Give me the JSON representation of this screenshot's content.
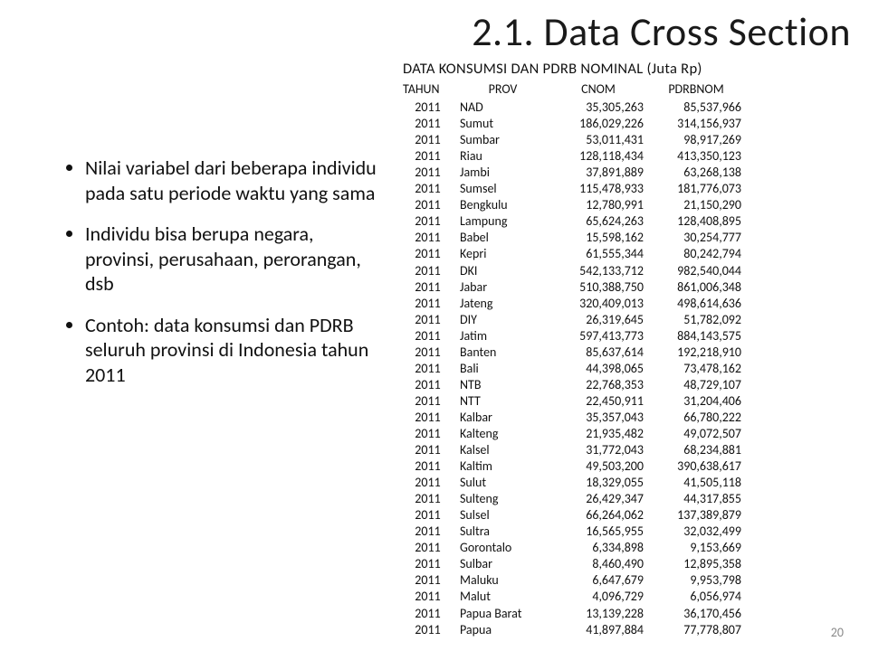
{
  "title": "2.1. Data Cross Section",
  "bullets": [
    "Nilai variabel dari beberapa individu pada satu periode waktu yang sama",
    "Individu bisa berupa negara, provinsi, perusahaan, perorangan, dsb",
    "Contoh: data konsumsi dan PDRB seluruh provinsi di Indonesia tahun 2011"
  ],
  "table": {
    "caption": "DATA KONSUMSI DAN PDRB NOMINAL (Juta Rp)",
    "headers": {
      "tahun": "TAHUN",
      "prov": "PROV",
      "cnom": "CNOM",
      "pdrbnom": "PDRBNOM"
    },
    "rows": [
      {
        "tahun": "2011",
        "prov": "NAD",
        "cnom": "35,305,263",
        "pdrbnom": "85,537,966"
      },
      {
        "tahun": "2011",
        "prov": "Sumut",
        "cnom": "186,029,226",
        "pdrbnom": "314,156,937"
      },
      {
        "tahun": "2011",
        "prov": "Sumbar",
        "cnom": "53,011,431",
        "pdrbnom": "98,917,269"
      },
      {
        "tahun": "2011",
        "prov": "Riau",
        "cnom": "128,118,434",
        "pdrbnom": "413,350,123"
      },
      {
        "tahun": "2011",
        "prov": "Jambi",
        "cnom": "37,891,889",
        "pdrbnom": "63,268,138"
      },
      {
        "tahun": "2011",
        "prov": "Sumsel",
        "cnom": "115,478,933",
        "pdrbnom": "181,776,073"
      },
      {
        "tahun": "2011",
        "prov": "Bengkulu",
        "cnom": "12,780,991",
        "pdrbnom": "21,150,290"
      },
      {
        "tahun": "2011",
        "prov": "Lampung",
        "cnom": "65,624,263",
        "pdrbnom": "128,408,895"
      },
      {
        "tahun": "2011",
        "prov": "Babel",
        "cnom": "15,598,162",
        "pdrbnom": "30,254,777"
      },
      {
        "tahun": "2011",
        "prov": "Kepri",
        "cnom": "61,555,344",
        "pdrbnom": "80,242,794"
      },
      {
        "tahun": "2011",
        "prov": "DKI",
        "cnom": "542,133,712",
        "pdrbnom": "982,540,044"
      },
      {
        "tahun": "2011",
        "prov": "Jabar",
        "cnom": "510,388,750",
        "pdrbnom": "861,006,348"
      },
      {
        "tahun": "2011",
        "prov": "Jateng",
        "cnom": "320,409,013",
        "pdrbnom": "498,614,636"
      },
      {
        "tahun": "2011",
        "prov": "DIY",
        "cnom": "26,319,645",
        "pdrbnom": "51,782,092"
      },
      {
        "tahun": "2011",
        "prov": "Jatim",
        "cnom": "597,413,773",
        "pdrbnom": "884,143,575"
      },
      {
        "tahun": "2011",
        "prov": "Banten",
        "cnom": "85,637,614",
        "pdrbnom": "192,218,910"
      },
      {
        "tahun": "2011",
        "prov": "Bali",
        "cnom": "44,398,065",
        "pdrbnom": "73,478,162"
      },
      {
        "tahun": "2011",
        "prov": "NTB",
        "cnom": "22,768,353",
        "pdrbnom": "48,729,107"
      },
      {
        "tahun": "2011",
        "prov": "NTT",
        "cnom": "22,450,911",
        "pdrbnom": "31,204,406"
      },
      {
        "tahun": "2011",
        "prov": "Kalbar",
        "cnom": "35,357,043",
        "pdrbnom": "66,780,222"
      },
      {
        "tahun": "2011",
        "prov": "Kalteng",
        "cnom": "21,935,482",
        "pdrbnom": "49,072,507"
      },
      {
        "tahun": "2011",
        "prov": "Kalsel",
        "cnom": "31,772,043",
        "pdrbnom": "68,234,881"
      },
      {
        "tahun": "2011",
        "prov": "Kaltim",
        "cnom": "49,503,200",
        "pdrbnom": "390,638,617"
      },
      {
        "tahun": "2011",
        "prov": "Sulut",
        "cnom": "18,329,055",
        "pdrbnom": "41,505,118"
      },
      {
        "tahun": "2011",
        "prov": "Sulteng",
        "cnom": "26,429,347",
        "pdrbnom": "44,317,855"
      },
      {
        "tahun": "2011",
        "prov": "Sulsel",
        "cnom": "66,264,062",
        "pdrbnom": "137,389,879"
      },
      {
        "tahun": "2011",
        "prov": "Sultra",
        "cnom": "16,565,955",
        "pdrbnom": "32,032,499"
      },
      {
        "tahun": "2011",
        "prov": "Gorontalo",
        "cnom": "6,334,898",
        "pdrbnom": "9,153,669"
      },
      {
        "tahun": "2011",
        "prov": "Sulbar",
        "cnom": "8,460,490",
        "pdrbnom": "12,895,358"
      },
      {
        "tahun": "2011",
        "prov": "Maluku",
        "cnom": "6,647,679",
        "pdrbnom": "9,953,798"
      },
      {
        "tahun": "2011",
        "prov": "Malut",
        "cnom": "4,096,729",
        "pdrbnom": "6,056,974"
      },
      {
        "tahun": "2011",
        "prov": "Papua Barat",
        "cnom": "13,139,228",
        "pdrbnom": "36,170,456"
      },
      {
        "tahun": "2011",
        "prov": "Papua",
        "cnom": "41,897,884",
        "pdrbnom": "77,778,807"
      }
    ]
  },
  "page_number": "20"
}
